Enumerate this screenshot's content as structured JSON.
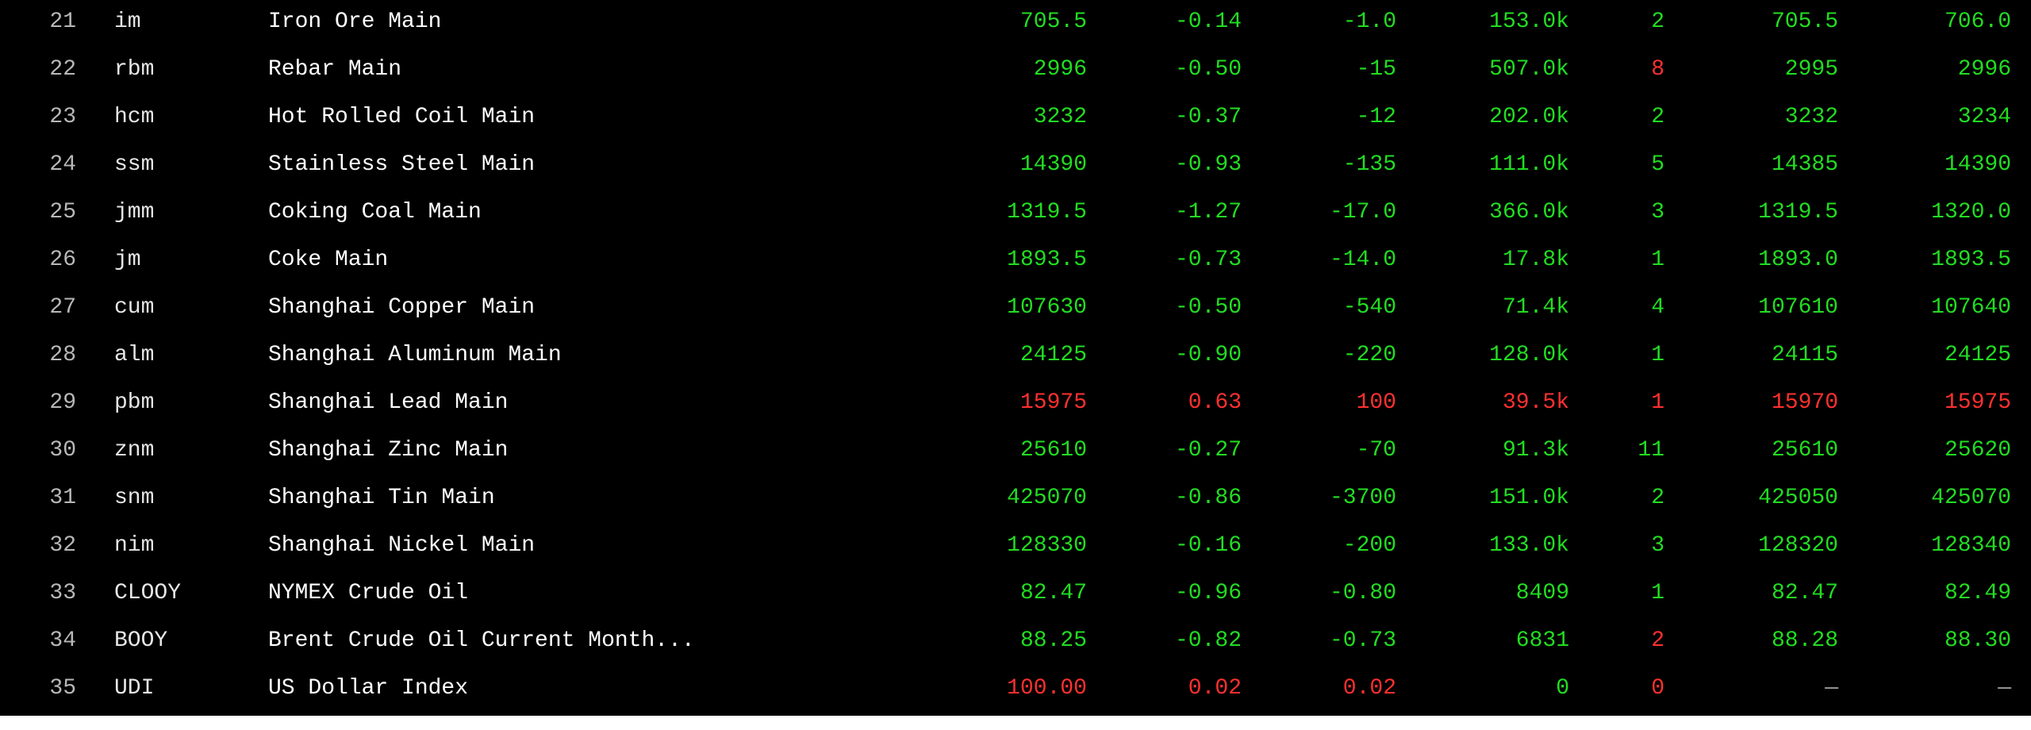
{
  "colors": {
    "up": "#ff3030",
    "down": "#22dd22"
  },
  "rows": [
    {
      "idx": "21",
      "code": "im",
      "name": "Iron Ore Main",
      "last": "705.5",
      "pct": "-0.14",
      "chg": "-1.0",
      "vol": "153.0k",
      "qty": "2",
      "bid": "705.5",
      "ask": "706.0",
      "dir": "down",
      "qty_dir": "down"
    },
    {
      "idx": "22",
      "code": "rbm",
      "name": "Rebar Main",
      "last": "2996",
      "pct": "-0.50",
      "chg": "-15",
      "vol": "507.0k",
      "qty": "8",
      "bid": "2995",
      "ask": "2996",
      "dir": "down",
      "qty_dir": "up"
    },
    {
      "idx": "23",
      "code": "hcm",
      "name": "Hot Rolled Coil Main",
      "last": "3232",
      "pct": "-0.37",
      "chg": "-12",
      "vol": "202.0k",
      "qty": "2",
      "bid": "3232",
      "ask": "3234",
      "dir": "down",
      "qty_dir": "down"
    },
    {
      "idx": "24",
      "code": "ssm",
      "name": "Stainless Steel Main",
      "last": "14390",
      "pct": "-0.93",
      "chg": "-135",
      "vol": "111.0k",
      "qty": "5",
      "bid": "14385",
      "ask": "14390",
      "dir": "down",
      "qty_dir": "down"
    },
    {
      "idx": "25",
      "code": "jmm",
      "name": "Coking Coal Main",
      "last": "1319.5",
      "pct": "-1.27",
      "chg": "-17.0",
      "vol": "366.0k",
      "qty": "3",
      "bid": "1319.5",
      "ask": "1320.0",
      "dir": "down",
      "qty_dir": "down"
    },
    {
      "idx": "26",
      "code": "jm",
      "name": "Coke Main",
      "last": "1893.5",
      "pct": "-0.73",
      "chg": "-14.0",
      "vol": "17.8k",
      "qty": "1",
      "bid": "1893.0",
      "ask": "1893.5",
      "dir": "down",
      "qty_dir": "down"
    },
    {
      "idx": "27",
      "code": "cum",
      "name": "Shanghai Copper Main",
      "last": "107630",
      "pct": "-0.50",
      "chg": "-540",
      "vol": "71.4k",
      "qty": "4",
      "bid": "107610",
      "ask": "107640",
      "dir": "down",
      "qty_dir": "down"
    },
    {
      "idx": "28",
      "code": "alm",
      "name": "Shanghai Aluminum Main",
      "last": "24125",
      "pct": "-0.90",
      "chg": "-220",
      "vol": "128.0k",
      "qty": "1",
      "bid": "24115",
      "ask": "24125",
      "dir": "down",
      "qty_dir": "down"
    },
    {
      "idx": "29",
      "code": "pbm",
      "name": "Shanghai Lead Main",
      "last": "15975",
      "pct": "0.63",
      "chg": "100",
      "vol": "39.5k",
      "qty": "1",
      "bid": "15970",
      "ask": "15975",
      "dir": "up",
      "qty_dir": "up"
    },
    {
      "idx": "30",
      "code": "znm",
      "name": "Shanghai Zinc Main",
      "last": "25610",
      "pct": "-0.27",
      "chg": "-70",
      "vol": "91.3k",
      "qty": "11",
      "bid": "25610",
      "ask": "25620",
      "dir": "down",
      "qty_dir": "down"
    },
    {
      "idx": "31",
      "code": "snm",
      "name": "Shanghai Tin Main",
      "last": "425070",
      "pct": "-0.86",
      "chg": "-3700",
      "vol": "151.0k",
      "qty": "2",
      "bid": "425050",
      "ask": "425070",
      "dir": "down",
      "qty_dir": "down"
    },
    {
      "idx": "32",
      "code": "nim",
      "name": "Shanghai Nickel Main",
      "last": "128330",
      "pct": "-0.16",
      "chg": "-200",
      "vol": "133.0k",
      "qty": "3",
      "bid": "128320",
      "ask": "128340",
      "dir": "down",
      "qty_dir": "down"
    },
    {
      "idx": "33",
      "code": "CLOOY",
      "name": "NYMEX Crude Oil",
      "last": "82.47",
      "pct": "-0.96",
      "chg": "-0.80",
      "vol": "8409",
      "qty": "1",
      "bid": "82.47",
      "ask": "82.49",
      "dir": "down",
      "qty_dir": "down"
    },
    {
      "idx": "34",
      "code": "BOOY",
      "name": "Brent Crude Oil Current Month...",
      "last": "88.25",
      "pct": "-0.82",
      "chg": "-0.73",
      "vol": "6831",
      "qty": "2",
      "bid": "88.28",
      "ask": "88.30",
      "dir": "down",
      "qty_dir": "up"
    },
    {
      "idx": "35",
      "code": "UDI",
      "name": "US Dollar Index",
      "last": "100.00",
      "pct": "0.02",
      "chg": "0.02",
      "vol": "0",
      "qty": "0",
      "bid": "—",
      "ask": "—",
      "dir": "up",
      "qty_dir": "up",
      "vol_dir": "down",
      "bid_dir": "neutral",
      "ask_dir": "neutral"
    }
  ]
}
